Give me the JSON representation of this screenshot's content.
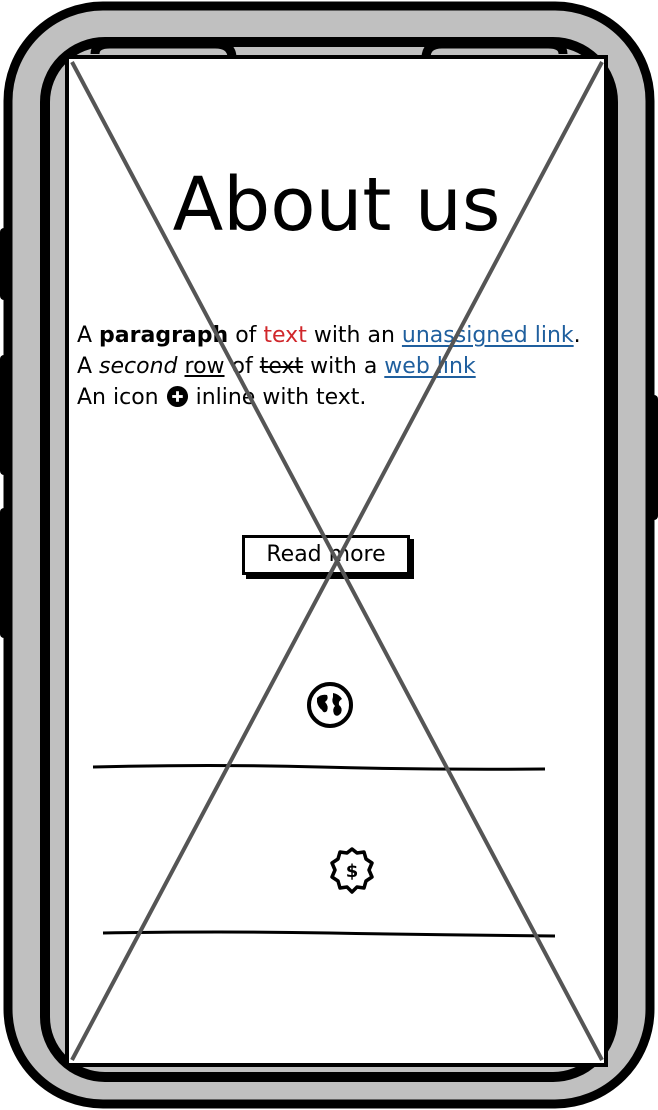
{
  "page": {
    "title": "About us",
    "lines": [
      {
        "w1": "A ",
        "bold": "paragraph",
        "w2": " of ",
        "red": "text",
        "w3": " with an ",
        "link": "unassigned link",
        "w4": "."
      },
      {
        "w1": "A ",
        "italic": "second",
        "w2": " ",
        "underline": "row",
        "w3": " of ",
        "strike": "text",
        "w4": " with a ",
        "link": "web link"
      },
      {
        "w1": "An icon ",
        "icon": "plus-circle-icon",
        "w2": " inline with text."
      }
    ],
    "button": "Read more",
    "icons": [
      "globe-icon",
      "dollar-badge-icon"
    ]
  },
  "colors": {
    "frame_fill": "#c0c0c0",
    "red_text": "#d0272b",
    "link": "#1f5f9e",
    "placeholder_x": "#555555"
  }
}
